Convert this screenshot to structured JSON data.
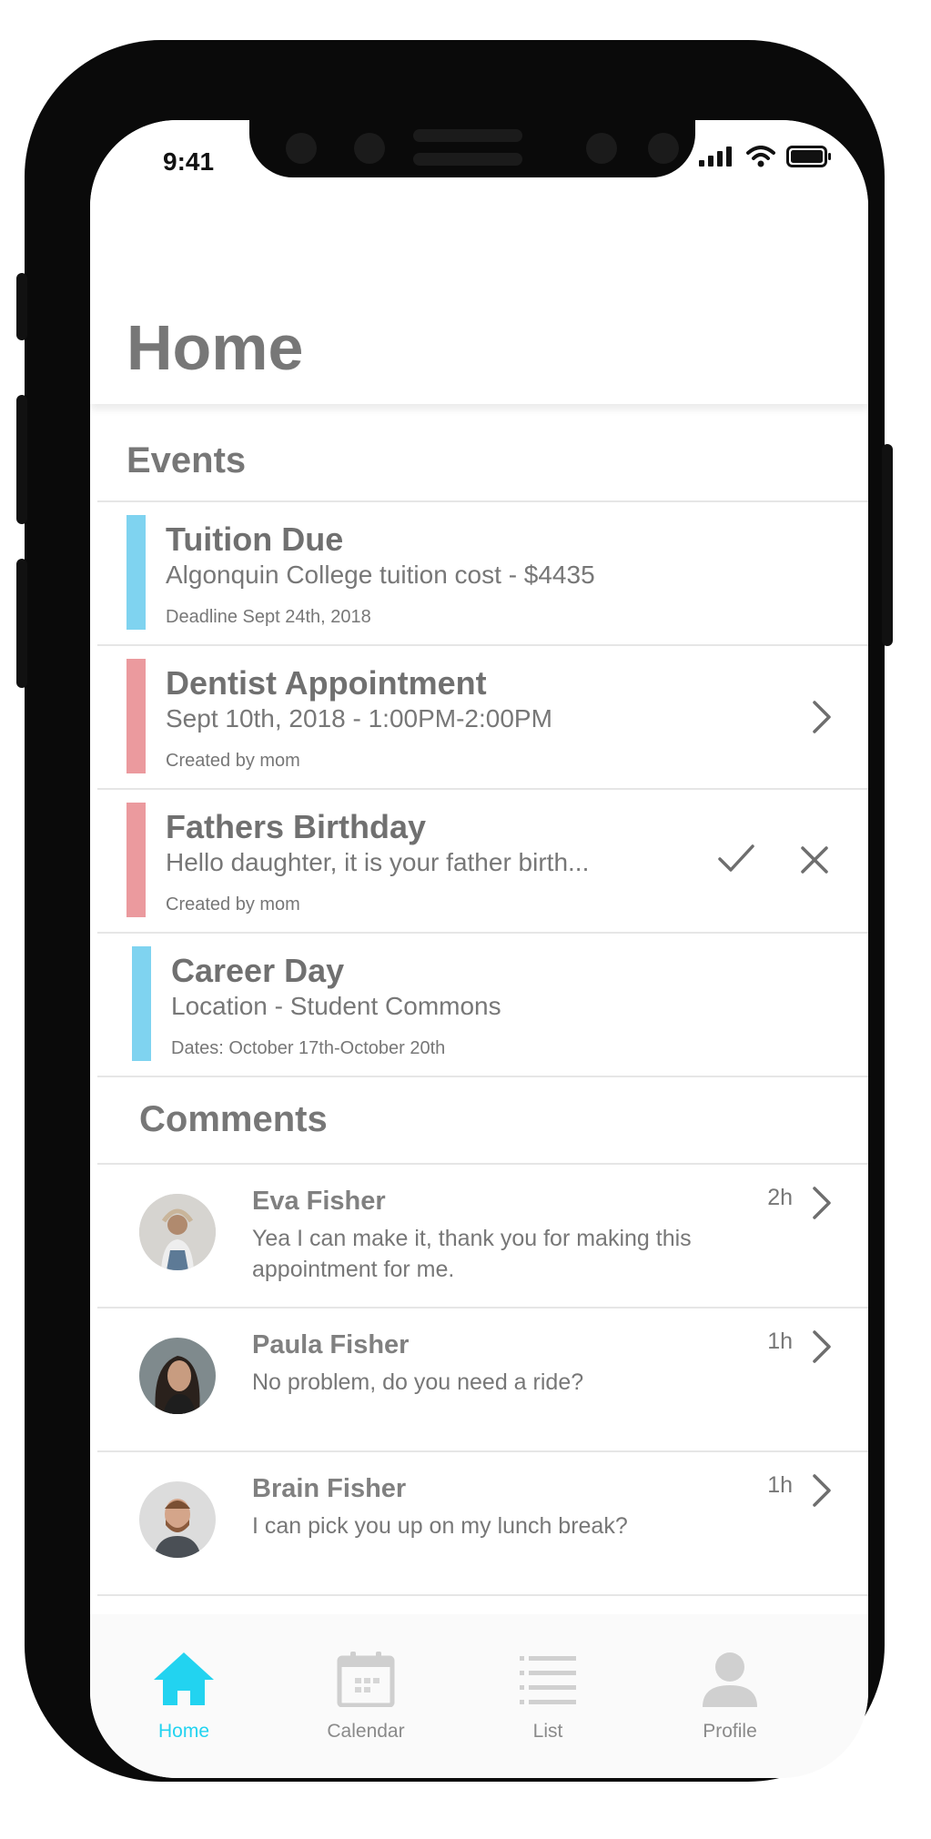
{
  "status_bar": {
    "time": "9:41"
  },
  "header": {
    "title": "Home"
  },
  "events": {
    "section_title": "Events",
    "colors": {
      "blue": "#7fd3f0",
      "pink": "#eb9a9e"
    },
    "items": [
      {
        "title": "Tuition Due",
        "subtitle": "Algonquin College tuition cost - $4435",
        "meta": "Deadline Sept 24th, 2018",
        "accent": "#7fd3f0"
      },
      {
        "title": "Dentist Appointment",
        "subtitle": "Sept 10th, 2018 - 1:00PM-2:00PM",
        "meta": "Created by mom",
        "accent": "#eb9a9e",
        "action_icon": "chevron-right-icon"
      },
      {
        "title": "Fathers Birthday",
        "subtitle": "Hello daughter, it is your father birth...",
        "meta": "Created by mom",
        "accent": "#eb9a9e",
        "action_icons": [
          "check-icon",
          "close-icon"
        ]
      },
      {
        "title": "Career Day",
        "subtitle": "Location - Student Commons",
        "meta": "Dates: October 17th-October 20th",
        "accent": "#7fd3f0"
      }
    ]
  },
  "comments": {
    "section_title": "Comments",
    "items": [
      {
        "name": "Eva Fisher",
        "text": "Yea I can make it, thank you for making this appointment for me.",
        "time": "2h"
      },
      {
        "name": "Paula Fisher",
        "text": "No problem, do you need a ride?",
        "time": "1h"
      },
      {
        "name": "Brain Fisher",
        "text": "I can pick you up on my lunch break?",
        "time": "1h"
      }
    ]
  },
  "tab_bar": {
    "accent": "#22d3f0",
    "items": [
      {
        "label": "Home",
        "icon": "home-icon",
        "active": true
      },
      {
        "label": "Calendar",
        "icon": "calendar-icon",
        "active": false
      },
      {
        "label": "List",
        "icon": "list-icon",
        "active": false
      },
      {
        "label": "Profile",
        "icon": "profile-icon",
        "active": false
      }
    ]
  }
}
